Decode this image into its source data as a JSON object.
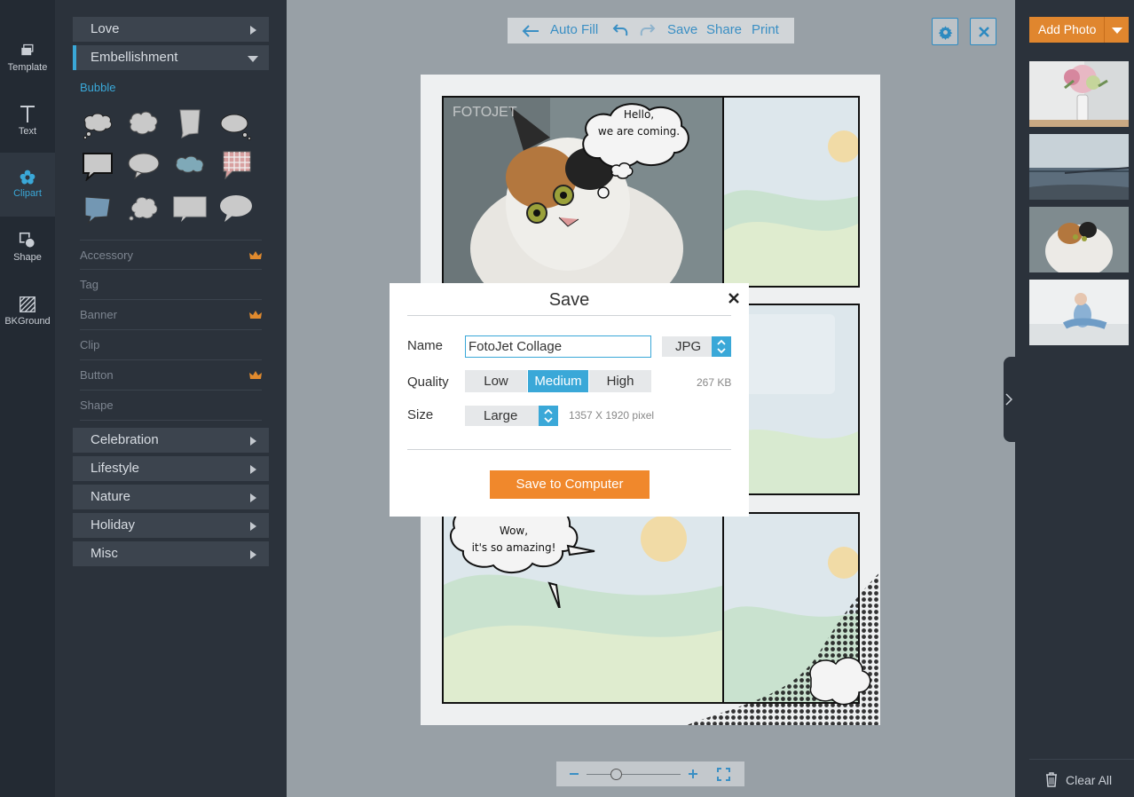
{
  "rail": [
    {
      "label": "Template",
      "icon": "template-icon"
    },
    {
      "label": "Text",
      "icon": "text-icon"
    },
    {
      "label": "Clipart",
      "icon": "clipart-icon",
      "active": true
    },
    {
      "label": "Shape",
      "icon": "shape-icon"
    },
    {
      "label": "BKGround",
      "icon": "background-icon"
    }
  ],
  "panel": {
    "categories_top": [
      "Love",
      "Embellishment"
    ],
    "open_category": "Embellishment",
    "subsection": "Bubble",
    "subitems": [
      {
        "label": "Accessory",
        "premium": true
      },
      {
        "label": "Tag",
        "premium": false
      },
      {
        "label": "Banner",
        "premium": true
      },
      {
        "label": "Clip",
        "premium": false
      },
      {
        "label": "Button",
        "premium": true
      },
      {
        "label": "Shape",
        "premium": false
      }
    ],
    "categories_bottom": [
      "Celebration",
      "Lifestyle",
      "Nature",
      "Holiday",
      "Misc"
    ]
  },
  "toolbar": {
    "autofill": "Auto Fill",
    "save": "Save",
    "share": "Share",
    "print": "Print"
  },
  "canvas": {
    "watermark": "FOTOJET",
    "bubble1": [
      "Hello,",
      "we are coming."
    ],
    "bubble2": [
      "Wow,",
      "it's so amazing!"
    ]
  },
  "right": {
    "add_photo": "Add Photo",
    "clear_all": "Clear All"
  },
  "dialog": {
    "title": "Save",
    "name_label": "Name",
    "name_value": "FotoJet Collage",
    "format": "JPG",
    "quality_label": "Quality",
    "quality_options": [
      "Low",
      "Medium",
      "High"
    ],
    "quality_selected": "Medium",
    "file_size": "267 KB",
    "size_label": "Size",
    "size_value": "Large",
    "dimensions": "1357 X 1920 pixel",
    "save_button": "Save to Computer"
  },
  "colors": {
    "accent": "#3aa8d8",
    "orange": "#f0882c"
  }
}
